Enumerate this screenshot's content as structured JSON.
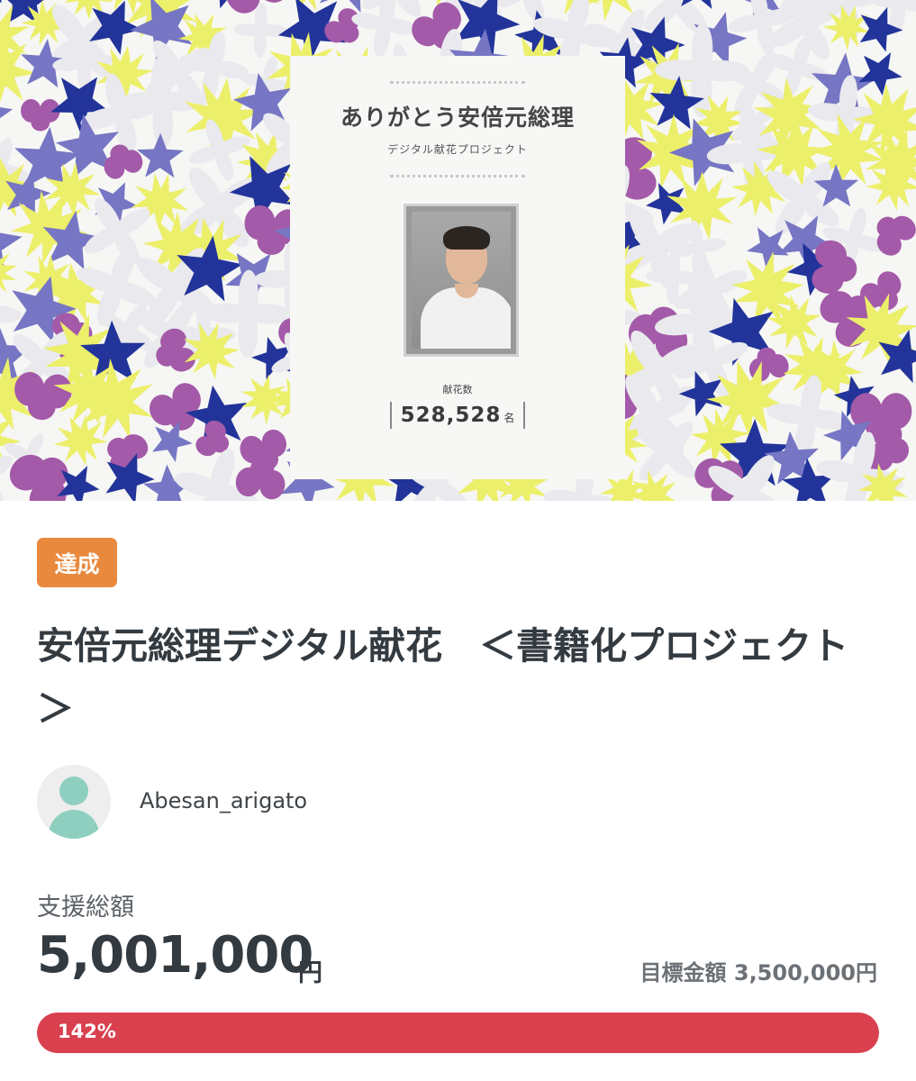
{
  "hero": {
    "title": "ありがとう安倍元総理",
    "subtitle": "デジタル献花プロジェクト",
    "counter_label": "献花数",
    "counter_value": "528,528",
    "counter_unit": "名",
    "colors": {
      "yellow": "#ecef6a",
      "blue": "#22349a",
      "lavender": "#7676c4",
      "orchid": "#a35aa8",
      "white_petal": "#e9e9ee"
    }
  },
  "status_badge": "達成",
  "project_title": "安倍元総理デジタル献花　＜書籍化プロジェクト＞",
  "owner": {
    "name": "Abesan_arigato",
    "avatar_icon": "user-avatar-icon"
  },
  "funding": {
    "total_label": "支援総額",
    "total_amount": "5,001,000",
    "total_unit": "円",
    "goal_text": "目標金額 3,500,000円",
    "progress_text": "142%",
    "progress_fraction": 1.0,
    "accent_color": "#d9414f"
  }
}
